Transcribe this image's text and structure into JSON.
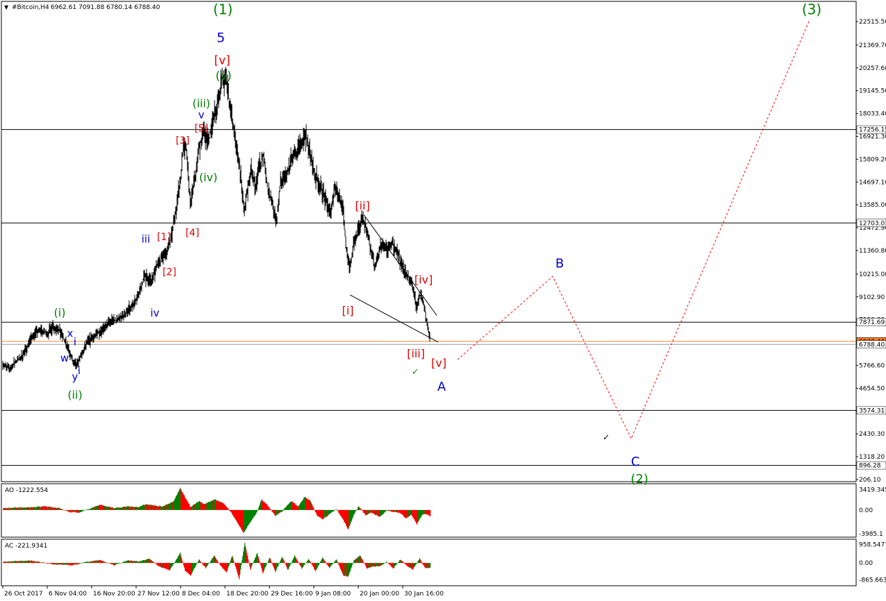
{
  "header": {
    "symbol": "#Bitcoin,H4",
    "ohlc": "6962.61 7091.88 6780.14 6788.40"
  },
  "colors": {
    "background": "#ffffff",
    "price": "#000000",
    "green_bar": "#008000",
    "red_bar": "#ff0000",
    "projection": "#ff0000",
    "bid_line": "#ff7f27",
    "wave_green": "#008000",
    "wave_blue": "#0000cc",
    "wave_red": "#e00000"
  },
  "chart_data": [
    {
      "type": "line",
      "name": "main-price",
      "price_scale_labels": [
        "22515.50",
        "21369.70",
        "20257.60",
        "19145.50",
        "18033.40",
        "16921.30",
        "15809.20",
        "14697.10",
        "13585.00",
        "12472.90",
        "11360.80",
        "10215.00",
        "9102.90",
        "7990.80",
        "6878.70",
        "5766.60",
        "4654.50",
        "3542.40",
        "2430.30",
        "1318.20",
        "206.10"
      ],
      "ylim": [
        206.1,
        22515.5
      ],
      "level_lines": [
        17256.15,
        12703.01,
        7871.69,
        3574.31,
        896.28
      ],
      "level_labels": [
        "17256.15",
        "12703.01",
        "7871.69",
        "3574.31",
        "896.28"
      ],
      "current_price": 6788.4,
      "current_price_label": "6788.40",
      "bid_label": "6938.40",
      "x_axis_labels": [
        "26 Oct 2017",
        "6 Nov 04:00",
        "16 Nov 20:00",
        "27 Nov 12:00",
        "8 Dec 04:00",
        "18 Dec 20:00",
        "29 Dec 16:00",
        "9 Jan 08:00",
        "20 Jan 00:00",
        "30 Jan 16:00"
      ],
      "x_axis_bar_index": [
        0,
        64,
        128,
        192,
        256,
        320,
        384,
        448,
        512,
        576
      ],
      "bars_total": 615,
      "price_path": [
        [
          0,
          5800
        ],
        [
          10,
          5600
        ],
        [
          20,
          6000
        ],
        [
          30,
          6300
        ],
        [
          38,
          6900
        ],
        [
          45,
          7300
        ],
        [
          55,
          7500
        ],
        [
          65,
          7300
        ],
        [
          72,
          7700
        ],
        [
          80,
          7500
        ],
        [
          86,
          7200
        ],
        [
          92,
          6800
        ],
        [
          98,
          6200
        ],
        [
          102,
          5900
        ],
        [
          106,
          5700
        ],
        [
          110,
          6100
        ],
        [
          116,
          6400
        ],
        [
          122,
          6900
        ],
        [
          130,
          7100
        ],
        [
          140,
          7400
        ],
        [
          150,
          7800
        ],
        [
          165,
          8000
        ],
        [
          178,
          8300
        ],
        [
          188,
          8700
        ],
        [
          196,
          9200
        ],
        [
          204,
          10200
        ],
        [
          212,
          9800
        ],
        [
          220,
          10400
        ],
        [
          228,
          11000
        ],
        [
          236,
          11200
        ],
        [
          244,
          12200
        ],
        [
          250,
          13500
        ],
        [
          256,
          14800
        ],
        [
          260,
          16500
        ],
        [
          265,
          16200
        ],
        [
          270,
          13600
        ],
        [
          278,
          15200
        ],
        [
          284,
          16600
        ],
        [
          290,
          17300
        ],
        [
          296,
          16500
        ],
        [
          300,
          17200
        ],
        [
          304,
          17800
        ],
        [
          310,
          18600
        ],
        [
          316,
          19800
        ],
        [
          322,
          19500
        ],
        [
          330,
          17800
        ],
        [
          336,
          16600
        ],
        [
          342,
          15200
        ],
        [
          348,
          13200
        ],
        [
          352,
          14200
        ],
        [
          358,
          15400
        ],
        [
          364,
          14400
        ],
        [
          370,
          15600
        ],
        [
          376,
          16000
        ],
        [
          382,
          14300
        ],
        [
          388,
          13600
        ],
        [
          394,
          12700
        ],
        [
          400,
          14600
        ],
        [
          408,
          15000
        ],
        [
          416,
          15800
        ],
        [
          424,
          16100
        ],
        [
          430,
          16700
        ],
        [
          436,
          17000
        ],
        [
          442,
          16100
        ],
        [
          448,
          15200
        ],
        [
          454,
          14700
        ],
        [
          460,
          14300
        ],
        [
          466,
          13700
        ],
        [
          472,
          13200
        ],
        [
          478,
          14400
        ],
        [
          484,
          14100
        ],
        [
          490,
          13400
        ],
        [
          494,
          11600
        ],
        [
          500,
          10500
        ],
        [
          505,
          11600
        ],
        [
          512,
          12300
        ],
        [
          518,
          13100
        ],
        [
          524,
          12300
        ],
        [
          530,
          11500
        ],
        [
          536,
          10500
        ],
        [
          542,
          11300
        ],
        [
          548,
          11800
        ],
        [
          554,
          11200
        ],
        [
          560,
          11700
        ],
        [
          566,
          11500
        ],
        [
          572,
          10800
        ],
        [
          578,
          10300
        ],
        [
          584,
          10100
        ],
        [
          590,
          9700
        ],
        [
          596,
          8600
        ],
        [
          602,
          9300
        ],
        [
          606,
          8800
        ],
        [
          610,
          8000
        ],
        [
          614,
          7300
        ],
        [
          617,
          6788
        ]
      ],
      "channel_lines": [
        {
          "from": [
            520,
            13100
          ],
          "to": [
            625,
            8200
          ]
        },
        {
          "from": [
            500,
            9200
          ],
          "to": [
            627,
            6900
          ]
        }
      ],
      "projection_path": [
        [
          655,
          6050
        ],
        [
          792,
          10100
        ],
        [
          905,
          2200
        ],
        [
          1162,
          22600
        ]
      ],
      "wave_labels": [
        {
          "text": "(1)",
          "bar": 317,
          "price": 23050,
          "color": "green",
          "size": 20
        },
        {
          "text": "5",
          "bar": 314,
          "price": 21700,
          "color": "blue",
          "size": 19
        },
        {
          "text": "[v]",
          "bar": 316,
          "price": 20600,
          "color": "red",
          "size": 17
        },
        {
          "text": "(v)",
          "bar": 318,
          "price": 19850,
          "color": "green",
          "size": 17
        },
        {
          "text": "(iii)",
          "bar": 286,
          "price": 18500,
          "color": "green",
          "size": 16
        },
        {
          "text": "v",
          "bar": 286,
          "price": 17950,
          "color": "blue",
          "size": 15
        },
        {
          "text": "[5]",
          "bar": 286,
          "price": 17300,
          "color": "red",
          "size": 14
        },
        {
          "text": "[3]",
          "bar": 259,
          "price": 16700,
          "color": "red",
          "size": 14
        },
        {
          "text": "(iv)",
          "bar": 296,
          "price": 14900,
          "color": "green",
          "size": 16
        },
        {
          "text": "[4]",
          "bar": 273,
          "price": 12200,
          "color": "red",
          "size": 14
        },
        {
          "text": "[1]",
          "bar": 232,
          "price": 12000,
          "color": "red",
          "size": 14
        },
        {
          "text": "iii",
          "bar": 206,
          "price": 11900,
          "color": "blue",
          "size": 15
        },
        {
          "text": "[2]",
          "bar": 240,
          "price": 10300,
          "color": "red",
          "size": 14
        },
        {
          "text": "iv",
          "bar": 219,
          "price": 8300,
          "color": "blue",
          "size": 15
        },
        {
          "text": "(i)",
          "bar": 82,
          "price": 8300,
          "color": "green",
          "size": 16
        },
        {
          "text": "x",
          "bar": 97,
          "price": 7300,
          "color": "blue",
          "size": 15
        },
        {
          "text": "i",
          "bar": 104,
          "price": 6900,
          "color": "blue",
          "size": 15
        },
        {
          "text": "w",
          "bar": 89,
          "price": 6100,
          "color": "blue",
          "size": 15
        },
        {
          "text": "i",
          "bar": 110,
          "price": 5500,
          "color": "blue",
          "size": 15
        },
        {
          "text": "y",
          "bar": 104,
          "price": 5200,
          "color": "blue",
          "size": 15
        },
        {
          "text": "(ii)",
          "bar": 104,
          "price": 4300,
          "color": "green",
          "size": 16
        },
        {
          "text": "[ii]",
          "bar": 518,
          "price": 13500,
          "color": "red",
          "size": 16
        },
        {
          "text": "[iv]",
          "bar": 606,
          "price": 9900,
          "color": "red",
          "size": 16
        },
        {
          "text": "[i]",
          "bar": 497,
          "price": 8400,
          "color": "red",
          "size": 16
        },
        {
          "text": "[iii]",
          "bar": 595,
          "price": 6300,
          "color": "red",
          "size": 16
        },
        {
          "text": "[v]",
          "bar": 628,
          "price": 5850,
          "color": "red",
          "size": 16
        },
        {
          "text": "A",
          "bar": 632,
          "price": 4700,
          "color": "blue",
          "size": 18
        },
        {
          "text": "B",
          "bar": 802,
          "price": 10700,
          "color": "blue",
          "size": 18
        },
        {
          "text": "C",
          "bar": 911,
          "price": 1050,
          "color": "blue",
          "size": 18
        },
        {
          "text": "(2)",
          "bar": 917,
          "price": 200,
          "color": "green",
          "size": 18
        },
        {
          "text": "(3)",
          "bar": 1165,
          "price": 23050,
          "color": "green",
          "size": 20
        }
      ],
      "check_marks": [
        {
          "bar": 594,
          "price": 5450,
          "color": "green",
          "text": "✓"
        },
        {
          "bar": 869,
          "price": 2250,
          "color": "black",
          "text": "✓"
        }
      ]
    },
    {
      "type": "bar",
      "name": "AO",
      "label": "AO -1222.554",
      "ylim": [
        -4350,
        4200
      ],
      "price_scale_labels": [
        "3419.345",
        "0.00",
        "-3985.1"
      ],
      "scale_values": [
        3419.345,
        0,
        -3985.1
      ],
      "anchors": [
        [
          0,
          300
        ],
        [
          40,
          450
        ],
        [
          60,
          600
        ],
        [
          80,
          350
        ],
        [
          95,
          -350
        ],
        [
          110,
          -400
        ],
        [
          125,
          250
        ],
        [
          140,
          900
        ],
        [
          160,
          300
        ],
        [
          180,
          600
        ],
        [
          195,
          450
        ],
        [
          205,
          1000
        ],
        [
          215,
          800
        ],
        [
          230,
          600
        ],
        [
          245,
          1400
        ],
        [
          255,
          3700
        ],
        [
          262,
          2200
        ],
        [
          270,
          500
        ],
        [
          282,
          1500
        ],
        [
          290,
          1000
        ],
        [
          305,
          1800
        ],
        [
          318,
          1100
        ],
        [
          330,
          -700
        ],
        [
          340,
          -2600
        ],
        [
          346,
          -3900
        ],
        [
          356,
          -2000
        ],
        [
          365,
          -500
        ],
        [
          372,
          1800
        ],
        [
          380,
          900
        ],
        [
          392,
          -1000
        ],
        [
          402,
          -200
        ],
        [
          415,
          1500
        ],
        [
          425,
          600
        ],
        [
          434,
          2200
        ],
        [
          442,
          1600
        ],
        [
          452,
          -900
        ],
        [
          460,
          -1600
        ],
        [
          472,
          -500
        ],
        [
          480,
          200
        ],
        [
          490,
          -1700
        ],
        [
          497,
          -3300
        ],
        [
          505,
          -800
        ],
        [
          512,
          600
        ],
        [
          522,
          -900
        ],
        [
          530,
          -400
        ],
        [
          542,
          -1200
        ],
        [
          552,
          -100
        ],
        [
          562,
          -300
        ],
        [
          572,
          -500
        ],
        [
          580,
          -1400
        ],
        [
          588,
          -800
        ],
        [
          596,
          -2400
        ],
        [
          604,
          -700
        ],
        [
          612,
          -800
        ],
        [
          617,
          -1222
        ]
      ]
    },
    {
      "type": "bar",
      "name": "AC",
      "label": "AC -221.9341",
      "ylim": [
        -1100,
        1150
      ],
      "price_scale_labels": [
        "958.5477",
        "0.00",
        "-865.6634"
      ],
      "scale_values": [
        958.5477,
        0,
        -865.6634
      ],
      "anchors": [
        [
          0,
          60
        ],
        [
          40,
          120
        ],
        [
          70,
          -60
        ],
        [
          100,
          -120
        ],
        [
          120,
          60
        ],
        [
          140,
          150
        ],
        [
          160,
          -120
        ],
        [
          180,
          130
        ],
        [
          196,
          70
        ],
        [
          210,
          230
        ],
        [
          225,
          -180
        ],
        [
          240,
          -380
        ],
        [
          255,
          520
        ],
        [
          262,
          -380
        ],
        [
          270,
          -650
        ],
        [
          282,
          180
        ],
        [
          292,
          -260
        ],
        [
          304,
          380
        ],
        [
          314,
          -180
        ],
        [
          322,
          -480
        ],
        [
          330,
          380
        ],
        [
          340,
          -820
        ],
        [
          348,
          1050
        ],
        [
          356,
          -330
        ],
        [
          366,
          520
        ],
        [
          374,
          -520
        ],
        [
          384,
          280
        ],
        [
          392,
          -460
        ],
        [
          402,
          330
        ],
        [
          410,
          -380
        ],
        [
          420,
          380
        ],
        [
          430,
          -280
        ],
        [
          440,
          200
        ],
        [
          450,
          -420
        ],
        [
          460,
          270
        ],
        [
          470,
          -250
        ],
        [
          480,
          200
        ],
        [
          490,
          -650
        ],
        [
          497,
          -700
        ],
        [
          505,
          130
        ],
        [
          514,
          380
        ],
        [
          524,
          -280
        ],
        [
          532,
          -180
        ],
        [
          542,
          -180
        ],
        [
          552,
          60
        ],
        [
          562,
          -280
        ],
        [
          572,
          180
        ],
        [
          582,
          -160
        ],
        [
          590,
          -330
        ],
        [
          600,
          230
        ],
        [
          608,
          -280
        ],
        [
          617,
          -222
        ]
      ]
    }
  ]
}
